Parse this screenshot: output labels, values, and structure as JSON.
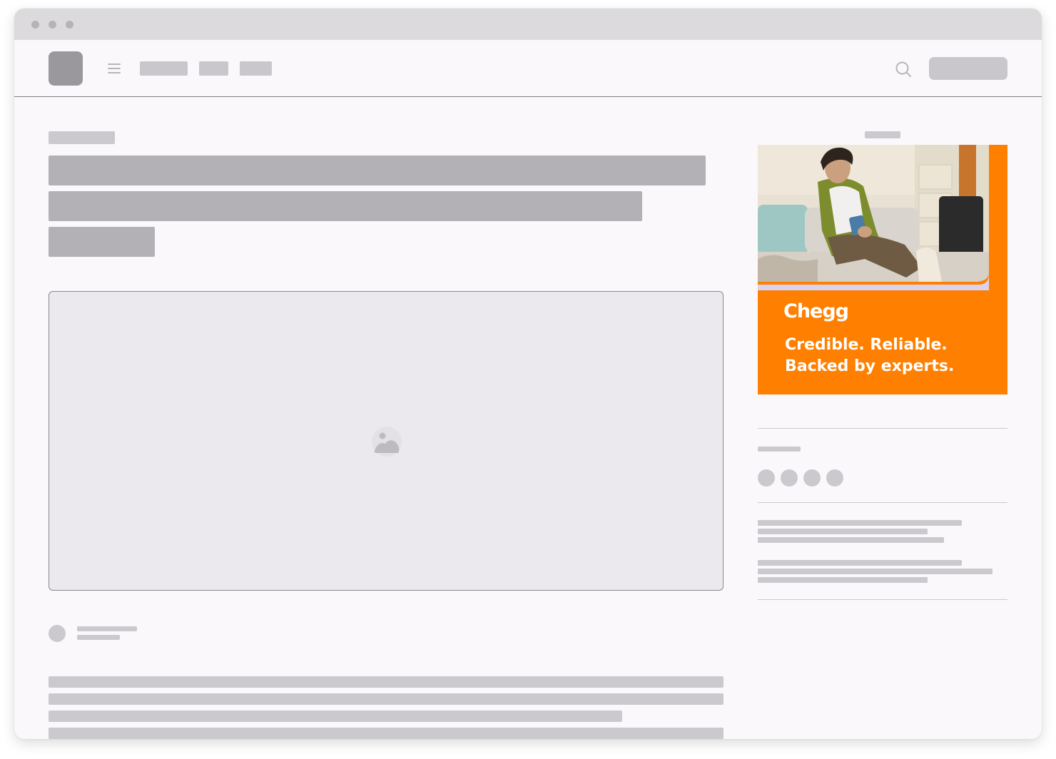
{
  "window": {
    "controls": [
      "close",
      "minimize",
      "maximize"
    ]
  },
  "header": {
    "logo_icon": "site-logo",
    "menu_icon": "hamburger-menu-icon",
    "search_icon": "search-icon"
  },
  "main": {
    "media_icon": "image-placeholder-icon"
  },
  "sidebar": {
    "ad": {
      "brand": "Chegg",
      "tagline_line1": "Credible. Reliable.",
      "tagline_line2": "Backed by experts.",
      "accent_color": "#ff7f00"
    },
    "social_icons": [
      "share-icon",
      "share-icon",
      "share-icon",
      "share-icon"
    ]
  },
  "colors": {
    "background": "#faf8fb",
    "placeholder": "#cbc9cd",
    "placeholder_dark": "#b3b1b5",
    "titlebar": "#dcdadd",
    "ad_orange": "#ff7f00"
  }
}
